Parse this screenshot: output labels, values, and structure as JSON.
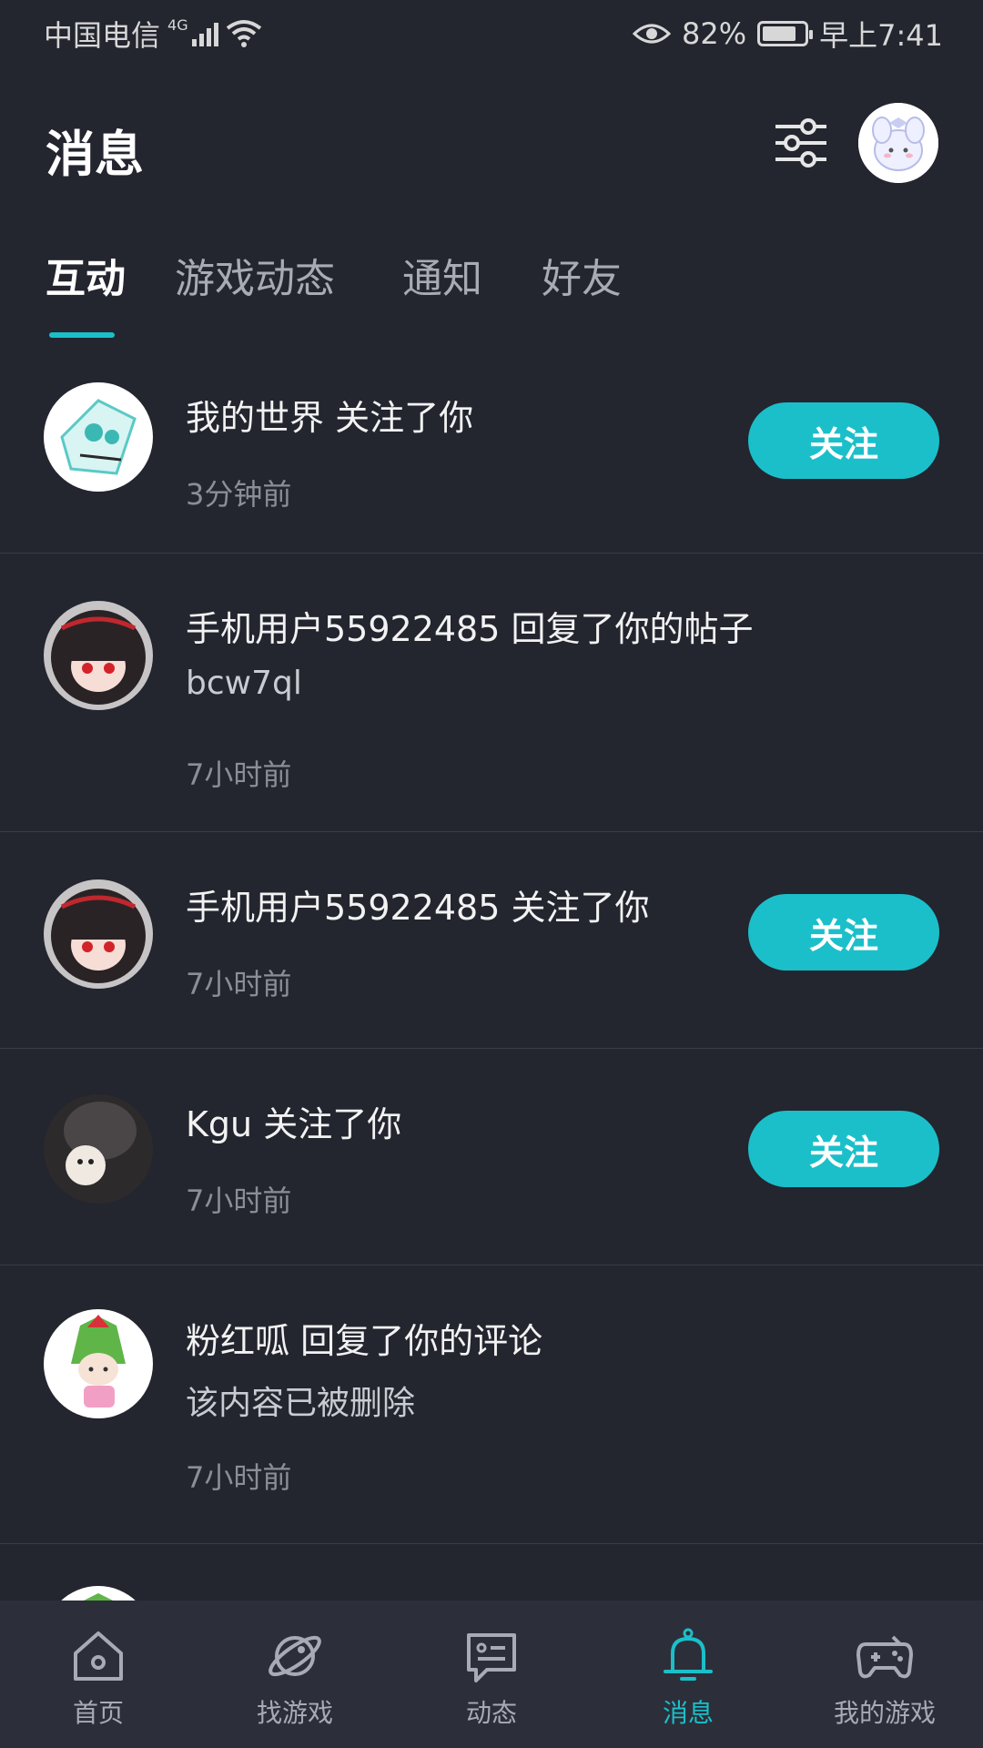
{
  "status_bar": {
    "carrier": "中国电信",
    "network": "4G",
    "battery": "82%",
    "battery_level": 0.82,
    "time": "早上7:41"
  },
  "header": {
    "title": "消息",
    "filter_icon": "sliders-icon"
  },
  "tabs": [
    {
      "label": "互动",
      "active": true
    },
    {
      "label": "游戏动态",
      "active": false
    },
    {
      "label": "通知",
      "active": false
    },
    {
      "label": "好友",
      "active": false
    }
  ],
  "notifications": [
    {
      "text": "我的世界 关注了你",
      "time": "3分钟前",
      "button": "关注"
    },
    {
      "text": "手机用户55922485 回复了你的帖子",
      "sub": "bcw7ql",
      "time": "7小时前"
    },
    {
      "text": "手机用户55922485 关注了你",
      "time": "7小时前",
      "button": "关注"
    },
    {
      "text": "Kgu 关注了你",
      "time": "7小时前",
      "button": "关注"
    },
    {
      "text": "粉红呱 回复了你的评论",
      "sub": "该内容已被删除",
      "time": "7小时前"
    }
  ],
  "bottom_nav": [
    {
      "label": "首页",
      "icon": "home-icon",
      "active": false
    },
    {
      "label": "找游戏",
      "icon": "planet-icon",
      "active": false
    },
    {
      "label": "动态",
      "icon": "chat-card-icon",
      "active": false
    },
    {
      "label": "消息",
      "icon": "bell-icon",
      "active": true
    },
    {
      "label": "我的游戏",
      "icon": "gamepad-icon",
      "active": false
    }
  ],
  "colors": {
    "background": "#23252f",
    "accent": "#1bbfc9",
    "nav_background": "#2c2f3a"
  }
}
